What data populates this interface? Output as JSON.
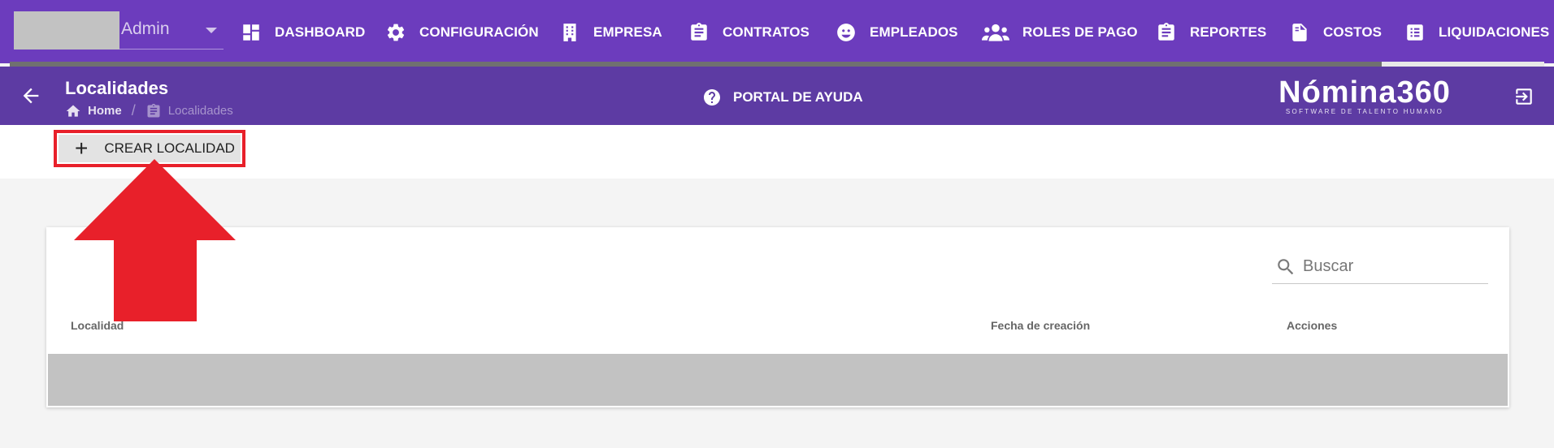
{
  "user": {
    "name": "Admin"
  },
  "nav": [
    {
      "label": "DASHBOARD",
      "icon": "dashboard-icon"
    },
    {
      "label": "CONFIGURACIÓN",
      "icon": "gear-icon"
    },
    {
      "label": "EMPRESA",
      "icon": "building-icon"
    },
    {
      "label": "CONTRATOS",
      "icon": "clipboard-icon"
    },
    {
      "label": "EMPLEADOS",
      "icon": "face-icon"
    },
    {
      "label": "ROLES DE PAGO",
      "icon": "users-icon"
    },
    {
      "label": "REPORTES",
      "icon": "clipboard-icon"
    },
    {
      "label": "COSTOS",
      "icon": "invoice-icon"
    },
    {
      "label": "LIQUIDACIONES",
      "icon": "list-icon"
    }
  ],
  "header": {
    "title": "Localidades",
    "breadcrumb": {
      "home": "Home",
      "current": "Localidades"
    },
    "help": "PORTAL DE AYUDA",
    "logo": "Nómina360",
    "logo_tagline": "SOFTWARE DE TALENTO HUMANO"
  },
  "toolbar": {
    "create_label": "CREAR LOCALIDAD"
  },
  "search": {
    "placeholder": "Buscar"
  },
  "table": {
    "columns": [
      "Localidad",
      "Fecha de creación",
      "Acciones"
    ]
  },
  "colors": {
    "nav_bg": "#6c3cbd",
    "subheader_bg": "#5d3ba3",
    "annotation_red": "#e8202a"
  }
}
